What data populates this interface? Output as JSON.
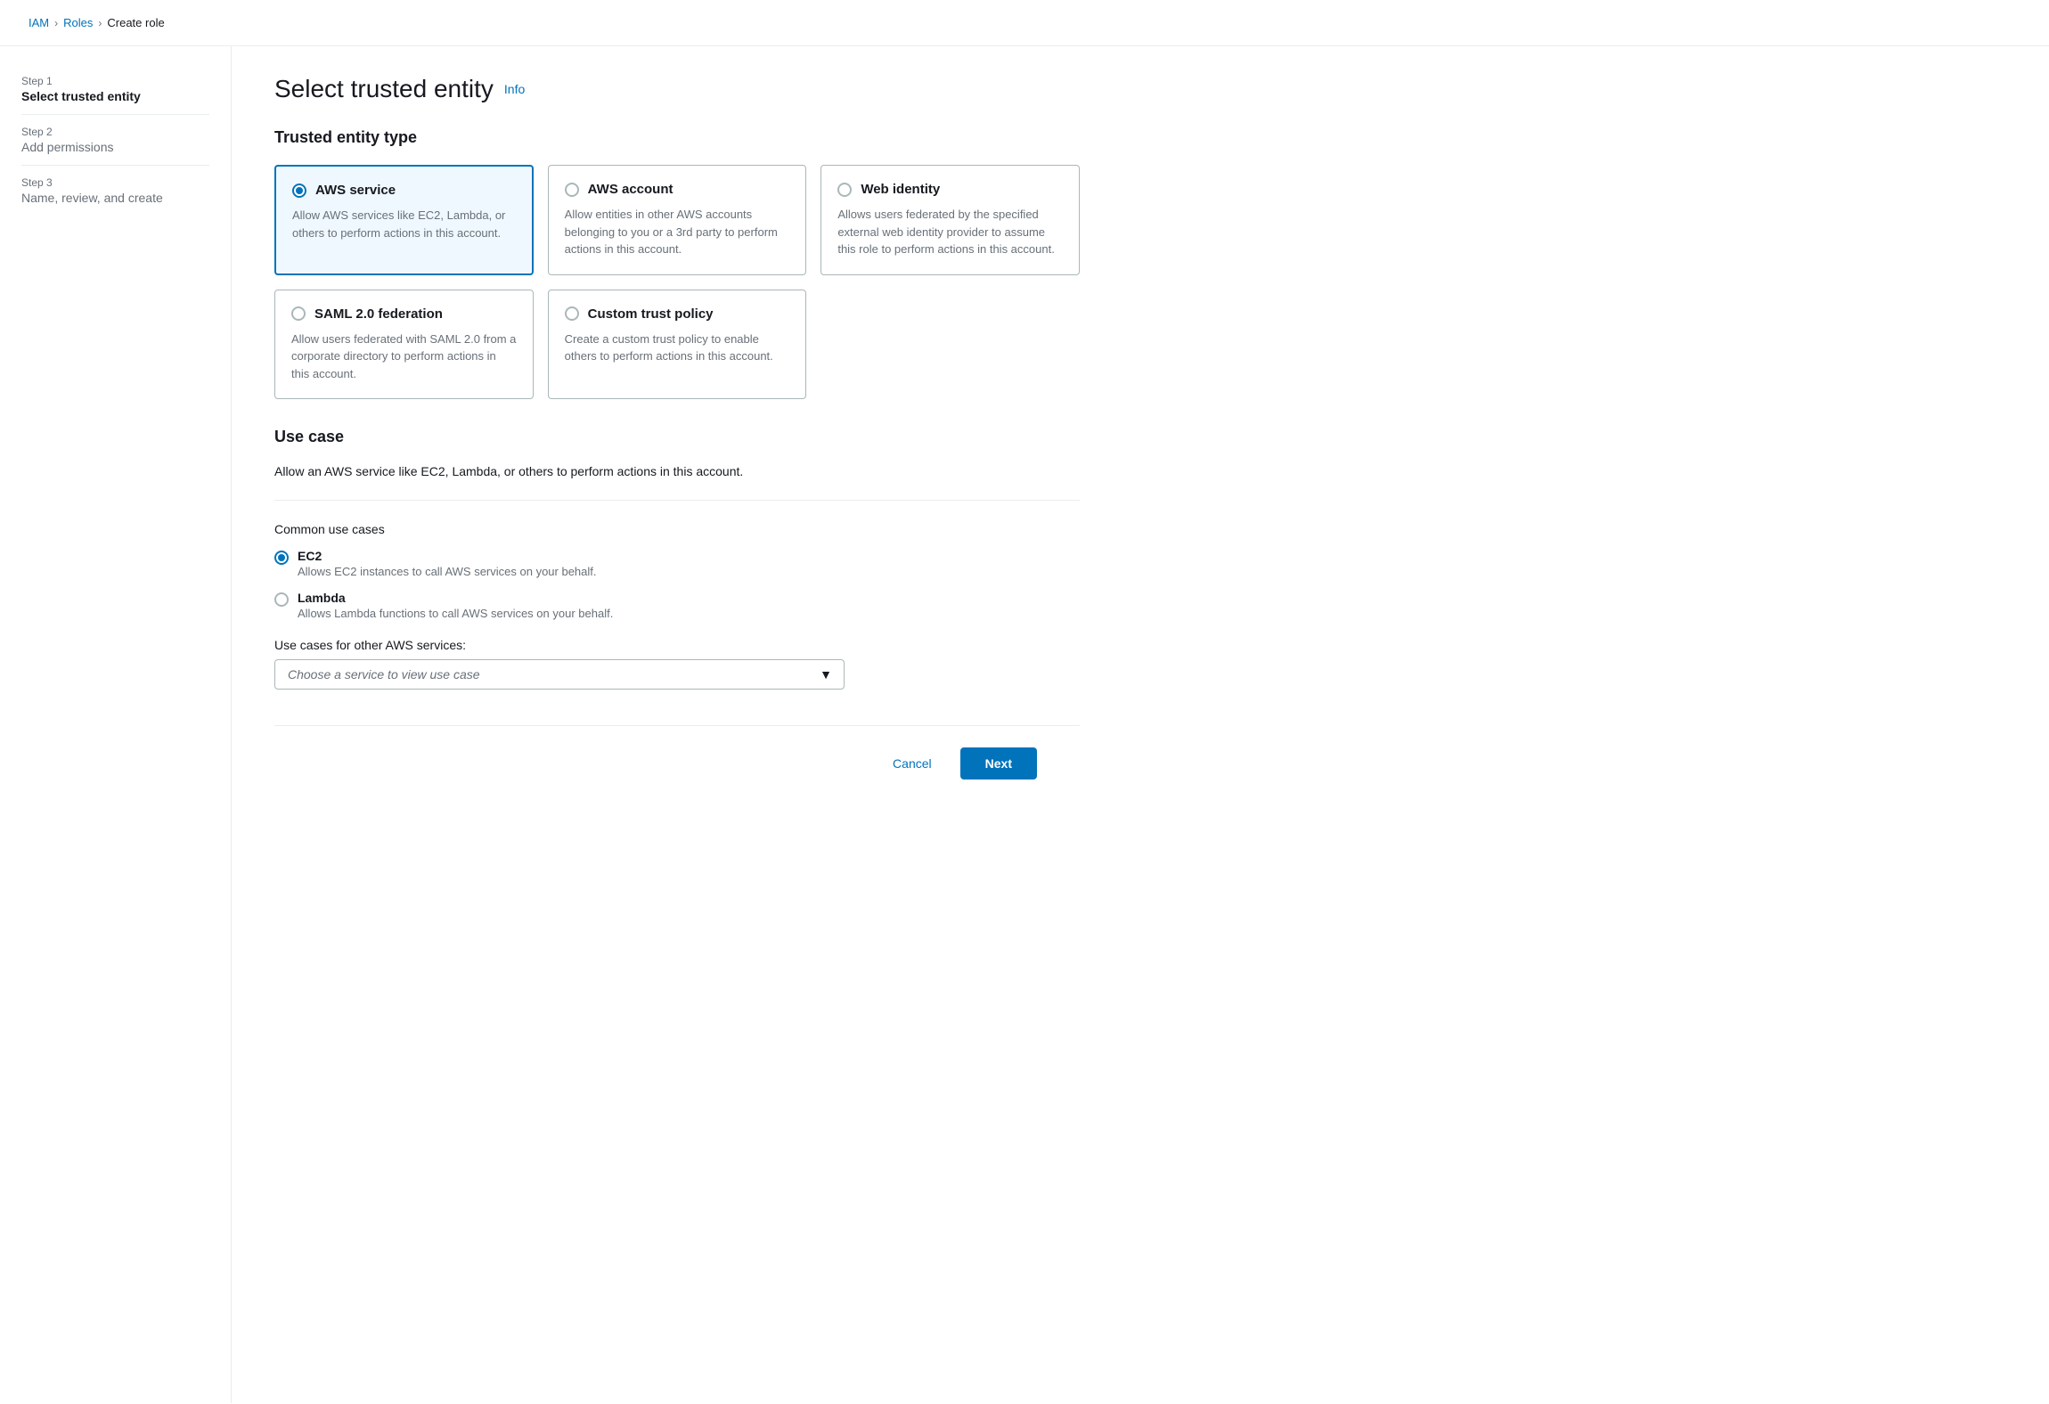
{
  "breadcrumb": {
    "items": [
      {
        "label": "IAM",
        "link": true
      },
      {
        "label": "Roles",
        "link": true
      },
      {
        "label": "Create role",
        "link": false
      }
    ]
  },
  "sidebar": {
    "steps": [
      {
        "step_label": "Step 1",
        "step_title": "Select trusted entity",
        "active": true
      },
      {
        "step_label": "Step 2",
        "step_title": "Add permissions",
        "active": false
      },
      {
        "step_label": "Step 3",
        "step_title": "Name, review, and create",
        "active": false
      }
    ]
  },
  "page": {
    "title": "Select trusted entity",
    "info_label": "Info",
    "trusted_entity_type_label": "Trusted entity type",
    "cards": [
      {
        "id": "aws-service",
        "title": "AWS service",
        "description": "Allow AWS services like EC2, Lambda, or others to perform actions in this account.",
        "selected": true
      },
      {
        "id": "aws-account",
        "title": "AWS account",
        "description": "Allow entities in other AWS accounts belonging to you or a 3rd party to perform actions in this account.",
        "selected": false
      },
      {
        "id": "web-identity",
        "title": "Web identity",
        "description": "Allows users federated by the specified external web identity provider to assume this role to perform actions in this account.",
        "selected": false
      },
      {
        "id": "saml-federation",
        "title": "SAML 2.0 federation",
        "description": "Allow users federated with SAML 2.0 from a corporate directory to perform actions in this account.",
        "selected": false
      },
      {
        "id": "custom-trust-policy",
        "title": "Custom trust policy",
        "description": "Create a custom trust policy to enable others to perform actions in this account.",
        "selected": false
      }
    ],
    "use_case": {
      "section_title": "Use case",
      "section_desc": "Allow an AWS service like EC2, Lambda, or others to perform actions in this account.",
      "common_label": "Common use cases",
      "options": [
        {
          "id": "ec2",
          "label": "EC2",
          "description": "Allows EC2 instances to call AWS services on your behalf.",
          "selected": true
        },
        {
          "id": "lambda",
          "label": "Lambda",
          "description": "Allows Lambda functions to call AWS services on your behalf.",
          "selected": false
        }
      ],
      "other_services_label": "Use cases for other AWS services:",
      "select_placeholder": "Choose a service to view use case"
    }
  },
  "footer": {
    "cancel_label": "Cancel",
    "next_label": "Next"
  }
}
